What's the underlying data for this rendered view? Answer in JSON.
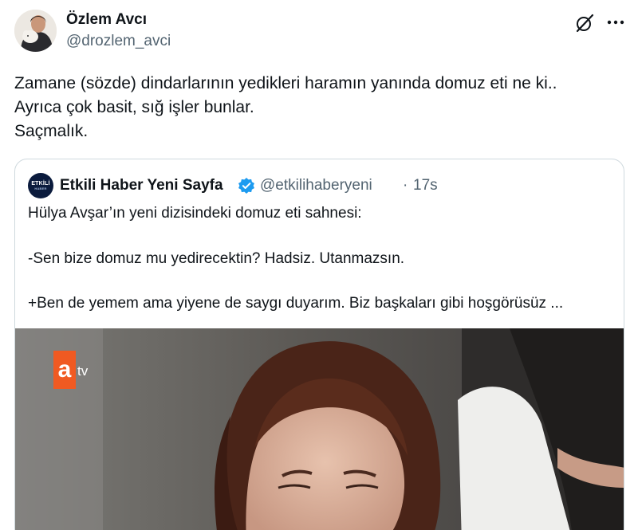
{
  "author": {
    "name": "Özlem Avcı",
    "handle": "@drozlem_avci",
    "avatar_icon": "avatar-photo"
  },
  "header_icons": {
    "grok": "grok-icon",
    "more": "more-options-icon"
  },
  "tweet": {
    "lines": [
      "Zamane (sözde) dindarlarının yedikleri haramın yanında domuz eti ne ki..",
      "Ayrıca çok basit, sığ işler bunlar.",
      "Saçmalık."
    ]
  },
  "quote": {
    "avatar_text": "ETKİLİ",
    "avatar_sub": "HABER",
    "name": "Etkili Haber Yeni Sayfa",
    "handle": "@etkilihaberyeni",
    "separator": "·",
    "time": "17s",
    "verified_color": "#1d9bf0",
    "lines": [
      "Hülya Avşar’ın yeni dizisindeki domuz eti sahnesi:",
      "-Sen bize domuz mu yedirecektin? Hadsiz. Utanmazsın.",
      "+Ben de yemem ama yiyene de saygı duyarım. Biz başkaları gibi hoşgörüsüz ..."
    ],
    "media": {
      "logo_letter": "a",
      "logo_suffix": "tv",
      "logo_color": "#f05a22"
    }
  }
}
